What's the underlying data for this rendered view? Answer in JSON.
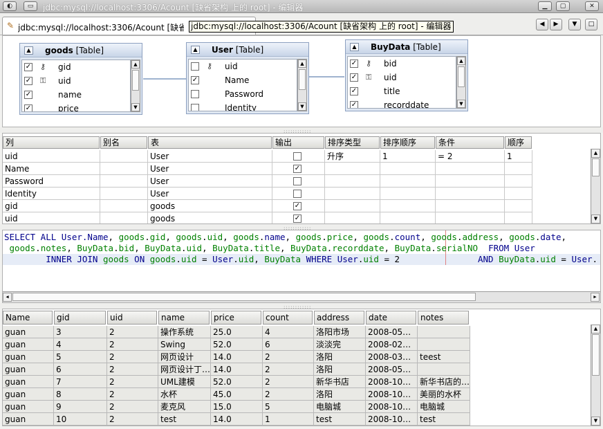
{
  "window": {
    "title": "jdbc:mysql://localhost:3306/Acount [缺省架构 上的 root] - 编辑器"
  },
  "tab": {
    "label": "jdbc:mysql://localhost:3306/Acount [缺省架构 上的 root] - 编辑器",
    "tooltip": "jdbc:mysql://localhost:3306/Acount [缺省架构 上的 root] - 编辑器"
  },
  "diagram": {
    "tables": [
      {
        "name": "goods",
        "kind": "[Table]",
        "fields": [
          {
            "name": "gid",
            "checked": true,
            "icon": "primary-key-icon"
          },
          {
            "name": "uid",
            "checked": true,
            "icon": "foreign-key-icon"
          },
          {
            "name": "name",
            "checked": true,
            "icon": ""
          },
          {
            "name": "price",
            "checked": true,
            "icon": ""
          }
        ]
      },
      {
        "name": "User",
        "kind": "[Table]",
        "fields": [
          {
            "name": "uid",
            "checked": false,
            "icon": "primary-key-icon"
          },
          {
            "name": "Name",
            "checked": true,
            "icon": ""
          },
          {
            "name": "Password",
            "checked": false,
            "icon": ""
          },
          {
            "name": "Identity",
            "checked": false,
            "icon": ""
          }
        ]
      },
      {
        "name": "BuyData",
        "kind": "[Table]",
        "fields": [
          {
            "name": "bid",
            "checked": true,
            "icon": "primary-key-icon"
          },
          {
            "name": "uid",
            "checked": true,
            "icon": "foreign-key-icon"
          },
          {
            "name": "title",
            "checked": true,
            "icon": ""
          },
          {
            "name": "recorddate",
            "checked": true,
            "icon": ""
          }
        ]
      }
    ]
  },
  "criteria": {
    "headers": [
      "列",
      "别名",
      "表",
      "输出",
      "排序类型",
      "排序顺序",
      "条件",
      "顺序"
    ],
    "rows": [
      {
        "column": "uid",
        "alias": "",
        "table": "User",
        "output": false,
        "sort_type": "升序",
        "sort_order": "1",
        "criteria": "= 2",
        "order": "1"
      },
      {
        "column": "Name",
        "alias": "",
        "table": "User",
        "output": true,
        "sort_type": "",
        "sort_order": "",
        "criteria": "",
        "order": ""
      },
      {
        "column": "Password",
        "alias": "",
        "table": "User",
        "output": false,
        "sort_type": "",
        "sort_order": "",
        "criteria": "",
        "order": ""
      },
      {
        "column": "Identity",
        "alias": "",
        "table": "User",
        "output": false,
        "sort_type": "",
        "sort_order": "",
        "criteria": "",
        "order": ""
      },
      {
        "column": "gid",
        "alias": "",
        "table": "goods",
        "output": true,
        "sort_type": "",
        "sort_order": "",
        "criteria": "",
        "order": ""
      },
      {
        "column": "uid",
        "alias": "",
        "table": "goods",
        "output": true,
        "sort_type": "",
        "sort_order": "",
        "criteria": "",
        "order": ""
      }
    ]
  },
  "sql": {
    "lines": [
      [
        [
          "kw",
          "SELECT ALL "
        ],
        [
          "fd",
          "User.Name"
        ],
        [
          "p",
          ", "
        ],
        [
          "tb",
          "goods"
        ],
        [
          "p",
          "."
        ],
        [
          "tb",
          "gid"
        ],
        [
          "p",
          ", "
        ],
        [
          "tb",
          "goods"
        ],
        [
          "p",
          "."
        ],
        [
          "tb",
          "uid"
        ],
        [
          "p",
          ", "
        ],
        [
          "tb",
          "goods"
        ],
        [
          "p",
          "."
        ],
        [
          "fd",
          "name"
        ],
        [
          "p",
          ", "
        ],
        [
          "tb",
          "goods"
        ],
        [
          "p",
          "."
        ],
        [
          "tb",
          "price"
        ],
        [
          "p",
          ", "
        ],
        [
          "tb",
          "goods"
        ],
        [
          "p",
          "."
        ],
        [
          "fd",
          "count"
        ],
        [
          "p",
          ", "
        ],
        [
          "tb",
          "goods"
        ],
        [
          "p",
          "."
        ],
        [
          "tb",
          "address"
        ],
        [
          "p",
          ", "
        ],
        [
          "tb",
          "goods"
        ],
        [
          "p",
          "."
        ],
        [
          "fd",
          "date"
        ],
        [
          "p",
          ","
        ]
      ],
      [
        [
          "p",
          " "
        ],
        [
          "tb",
          "goods"
        ],
        [
          "p",
          "."
        ],
        [
          "tb",
          "notes"
        ],
        [
          "p",
          ", "
        ],
        [
          "tb",
          "BuyData"
        ],
        [
          "p",
          "."
        ],
        [
          "tb",
          "bid"
        ],
        [
          "p",
          ", "
        ],
        [
          "tb",
          "BuyData"
        ],
        [
          "p",
          "."
        ],
        [
          "tb",
          "uid"
        ],
        [
          "p",
          ", "
        ],
        [
          "tb",
          "BuyData"
        ],
        [
          "p",
          "."
        ],
        [
          "tb",
          "title"
        ],
        [
          "p",
          ", "
        ],
        [
          "tb",
          "BuyData"
        ],
        [
          "p",
          "."
        ],
        [
          "tb",
          "recorddate"
        ],
        [
          "p",
          ", "
        ],
        [
          "tb",
          "BuyData"
        ],
        [
          "p",
          "."
        ],
        [
          "tb",
          "serialNO"
        ],
        [
          "kw",
          "  FROM "
        ],
        [
          "fd",
          "User"
        ]
      ],
      [
        [
          "kw",
          "        INNER JOIN "
        ],
        [
          "tb",
          "goods"
        ],
        [
          "kw",
          " ON "
        ],
        [
          "tb",
          "goods"
        ],
        [
          "p",
          "."
        ],
        [
          "tb",
          "uid"
        ],
        [
          "p",
          " = "
        ],
        [
          "fd",
          "User"
        ],
        [
          "p",
          "."
        ],
        [
          "tb",
          "uid"
        ],
        [
          "p",
          ", "
        ],
        [
          "tb",
          "BuyData"
        ],
        [
          "kw",
          " WHERE "
        ],
        [
          "fd",
          "User"
        ],
        [
          "p",
          "."
        ],
        [
          "tb",
          "uid"
        ],
        [
          "p",
          " = 2"
        ],
        [
          "p",
          "               "
        ],
        [
          "kw",
          "AND "
        ],
        [
          "tb",
          "BuyData"
        ],
        [
          "p",
          "."
        ],
        [
          "tb",
          "uid"
        ],
        [
          "p",
          " = "
        ],
        [
          "fd",
          "User"
        ],
        [
          "p",
          "."
        ]
      ]
    ]
  },
  "results": {
    "headers": [
      "Name",
      "gid",
      "uid",
      "name",
      "price",
      "count",
      "address",
      "date",
      "notes"
    ],
    "rows": [
      [
        "guan",
        "3",
        "2",
        "操作系统",
        "25.0",
        "4",
        "洛阳市场",
        "2008-05…",
        ""
      ],
      [
        "guan",
        "4",
        "2",
        "Swing",
        "52.0",
        "6",
        "淡淡完",
        "2008-02…",
        ""
      ],
      [
        "guan",
        "5",
        "2",
        "网页设计",
        "14.0",
        "2",
        "洛阳",
        "2008-03…",
        "teest"
      ],
      [
        "guan",
        "6",
        "2",
        "网页设计丁…",
        "14.0",
        "2",
        "洛阳",
        "2008-05…",
        ""
      ],
      [
        "guan",
        "7",
        "2",
        "UML建模",
        "52.0",
        "2",
        "新华书店",
        "2008-10…",
        "新华书店的…"
      ],
      [
        "guan",
        "8",
        "2",
        "水杯",
        "45.0",
        "2",
        "洛阳",
        "2008-10…",
        "美丽的水杯"
      ],
      [
        "guan",
        "9",
        "2",
        "麦克风",
        "15.0",
        "5",
        "电脑城",
        "2008-10…",
        "电脑城"
      ],
      [
        "guan",
        "10",
        "2",
        "test",
        "14.0",
        "1",
        "test",
        "2008-10…",
        "test"
      ]
    ]
  },
  "colors": {
    "keyword": "#00008b",
    "table_ref": "#008000",
    "selection": "#e6ecf7"
  }
}
